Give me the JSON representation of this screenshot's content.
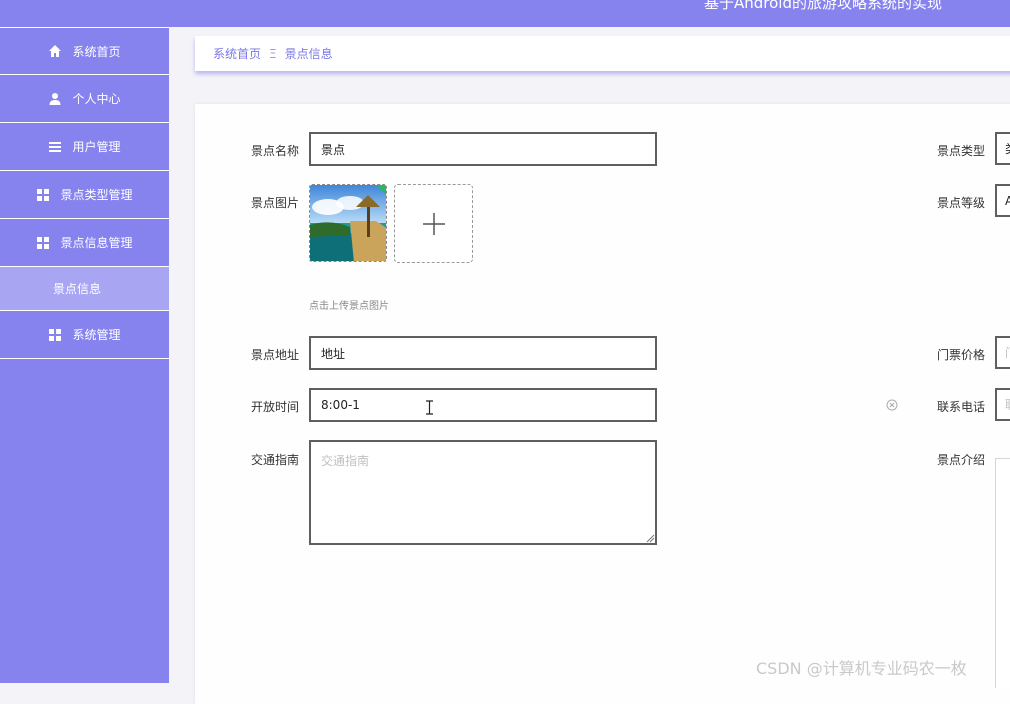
{
  "header": {
    "app_title": "基于Android的旅游攻略系统的实现"
  },
  "sidebar": {
    "items": [
      {
        "label": "系统首页",
        "icon": "home-icon"
      },
      {
        "label": "个人中心",
        "icon": "user-icon"
      },
      {
        "label": "用户管理",
        "icon": "list-icon"
      },
      {
        "label": "景点类型管理",
        "icon": "grid-icon"
      },
      {
        "label": "景点信息管理",
        "icon": "grid-icon"
      },
      {
        "label": "景点信息",
        "icon": ""
      },
      {
        "label": "系统管理",
        "icon": "grid-icon"
      }
    ]
  },
  "breadcrumb": {
    "home": "系统首页",
    "separator": "Ξ",
    "current": "景点信息"
  },
  "form": {
    "name_label": "景点名称",
    "name_value": "景点",
    "image_label": "景点图片",
    "upload_hint": "点击上传景点图片",
    "address_label": "景点地址",
    "address_value": "地址",
    "open_time_label": "开放时间",
    "open_time_value": "8:00-1",
    "traffic_label": "交通指南",
    "traffic_placeholder": "交通指南",
    "type_label": "景点类型",
    "type_value": "类",
    "level_label": "景点等级",
    "level_value": "A",
    "price_label": "门票价格",
    "price_value": "门",
    "phone_label": "联系电话",
    "phone_value": "联",
    "intro_label": "景点介绍"
  },
  "watermark": "CSDN @计算机专业码农一枚",
  "colors": {
    "accent": "#8683ef",
    "sub_item": "#a8a6f3",
    "breadcrumb_text": "#7b78e6"
  }
}
